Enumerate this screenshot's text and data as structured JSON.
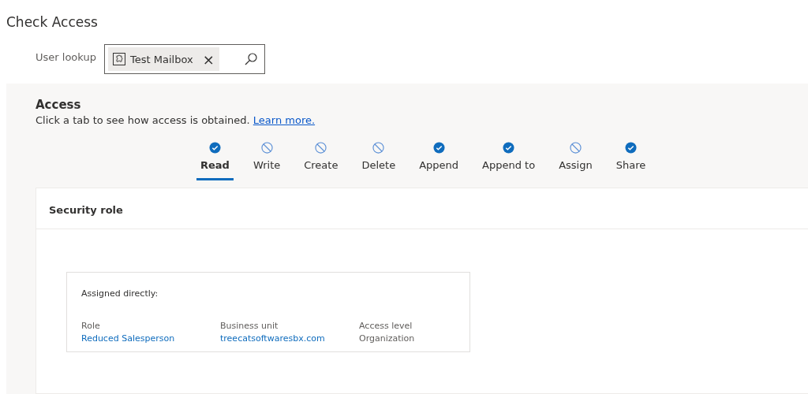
{
  "page": {
    "title": "Check Access"
  },
  "user_lookup": {
    "label": "User lookup",
    "value": "Test Mailbox",
    "clear": "×"
  },
  "access": {
    "heading": "Access",
    "description": "Click a tab to see how access is obtained.",
    "link": "Learn more."
  },
  "tabs": [
    {
      "label": "Read",
      "granted": true,
      "selected": true
    },
    {
      "label": "Write",
      "granted": false,
      "selected": false
    },
    {
      "label": "Create",
      "granted": false,
      "selected": false
    },
    {
      "label": "Delete",
      "granted": false,
      "selected": false
    },
    {
      "label": "Append",
      "granted": true,
      "selected": false
    },
    {
      "label": "Append to",
      "granted": true,
      "selected": false
    },
    {
      "label": "Assign",
      "granted": false,
      "selected": false
    },
    {
      "label": "Share",
      "granted": true,
      "selected": false
    }
  ],
  "section": {
    "title": "Security role"
  },
  "assignment": {
    "heading": "Assigned directly:",
    "columns": [
      {
        "label": "Role",
        "value": "Reduced Salesperson",
        "kind": "link"
      },
      {
        "label": "Business unit",
        "value": "treecatsoftwaresbx.com",
        "kind": "link"
      },
      {
        "label": "Access level",
        "value": "Organization",
        "kind": "text"
      }
    ]
  }
}
